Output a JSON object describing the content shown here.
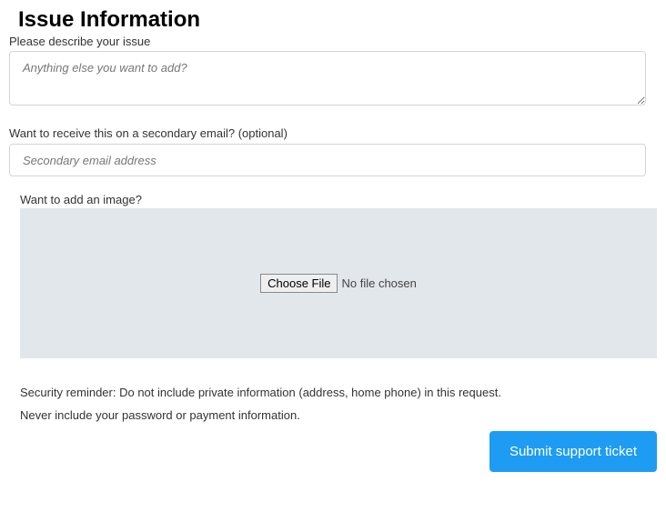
{
  "heading": "Issue Information",
  "issue": {
    "label": "Please describe your issue",
    "placeholder": "Anything else you want to add?"
  },
  "secondaryEmail": {
    "label": "Want to receive this on a secondary email? (optional)",
    "placeholder": "Secondary email address"
  },
  "imageUpload": {
    "label": "Want to add an image?",
    "buttonLabel": "Choose File",
    "status": "No file chosen"
  },
  "reminders": {
    "line1": "Security reminder: Do not include private information (address, home phone) in this request.",
    "line2": "Never include your password or payment information."
  },
  "submitLabel": "Submit support ticket"
}
